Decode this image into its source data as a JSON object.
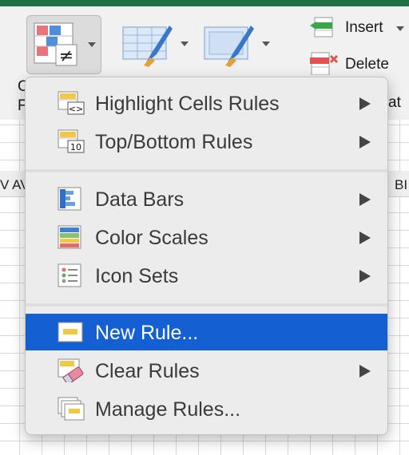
{
  "ribbon": {
    "insert_label": "Insert",
    "delete_label": "Delete",
    "format_fragment": "at",
    "cf_fragment_1": "C",
    "cf_fragment_2": "F"
  },
  "sheet": {
    "col_left_fragment": "V AV",
    "col_right_fragment": "BI"
  },
  "menu": {
    "items": [
      {
        "label": "Highlight Cells Rules",
        "icon": "highlight-cells-rules-icon",
        "submenu": true
      },
      {
        "label": "Top/Bottom Rules",
        "icon": "top-bottom-rules-icon",
        "submenu": true
      },
      {
        "label": "Data Bars",
        "icon": "data-bars-icon",
        "submenu": true
      },
      {
        "label": "Color Scales",
        "icon": "color-scales-icon",
        "submenu": true
      },
      {
        "label": "Icon Sets",
        "icon": "icon-sets-icon",
        "submenu": true
      },
      {
        "label": "New Rule...",
        "icon": "new-rule-icon",
        "submenu": false,
        "selected": true
      },
      {
        "label": "Clear Rules",
        "icon": "clear-rules-icon",
        "submenu": true
      },
      {
        "label": "Manage Rules...",
        "icon": "manage-rules-icon",
        "submenu": false
      }
    ],
    "top10_text": "10",
    "compare_text": "<>"
  },
  "colors": {
    "selection": "#1460d2",
    "excel_green": "#1e7145"
  }
}
